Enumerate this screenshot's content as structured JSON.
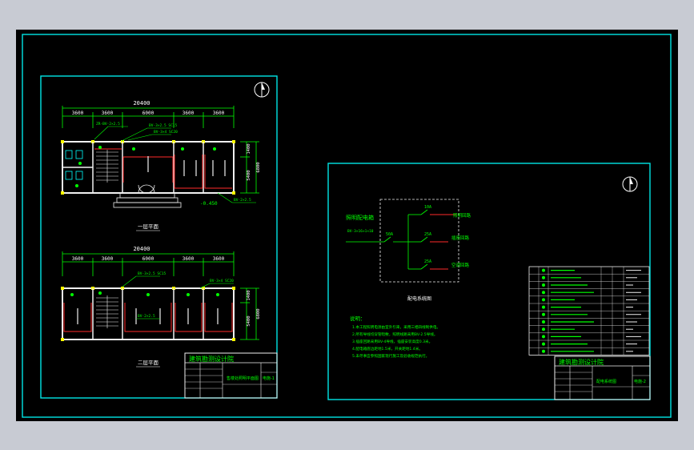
{
  "colors": {
    "background": "#c8cbd3",
    "canvas": "#000000",
    "frame": "#00e5e5",
    "wall": "#f0f0f0",
    "dimension": "#00ff00",
    "wire": "#ff2a2a",
    "accent": "#ffff00"
  },
  "left_sheet": {
    "north_arrow": "north-arrow-icon",
    "plan1": {
      "total_dim": "20400",
      "bays": [
        "3600",
        "3600",
        "6000",
        "3600",
        "3600"
      ],
      "right_dims": [
        "1400",
        "5400",
        "6800"
      ],
      "level_mark": "-0.450",
      "label": "一层平面"
    },
    "plan2": {
      "total_dim": "20400",
      "bays": [
        "3600",
        "3600",
        "6000",
        "3600",
        "3600"
      ],
      "right_dims": [
        "1400",
        "5400",
        "6800"
      ],
      "label": "二层平面"
    },
    "title_block": {
      "institute": "建筑勘测设计院",
      "project": "售楼处照明平面图",
      "sheet": "电施-1"
    }
  },
  "right_sheet": {
    "north_arrow": "north-arrow-icon",
    "diagram": {
      "panel_label": "照明配电箱",
      "incoming": "BV-3×16+1×10",
      "breaker_main": "50A",
      "breakers": [
        "10A",
        "25A",
        "25A"
      ],
      "outputs": [
        "照明回路",
        "插座回路",
        "空调回路"
      ],
      "label": "配电系统图"
    },
    "notes_title": "说明：",
    "notes": [
      "1.本工程照明电源由室外引来，采用三相四线制供电。",
      "2.所有导线均穿管暗敷，照明线路采用BV-2.5导线。",
      "3.插座回路采用BV-4导线，插座安装高度0.3米。",
      "4.配电箱底边距地1.5米，开关距地1.4米。",
      "5.未尽事宜参照国家现行施工及验收规范执行。"
    ],
    "legend_rows": 12,
    "title_block": {
      "institute": "建筑勘测设计院",
      "project": "配电系统图",
      "sheet": "电施-2"
    }
  }
}
